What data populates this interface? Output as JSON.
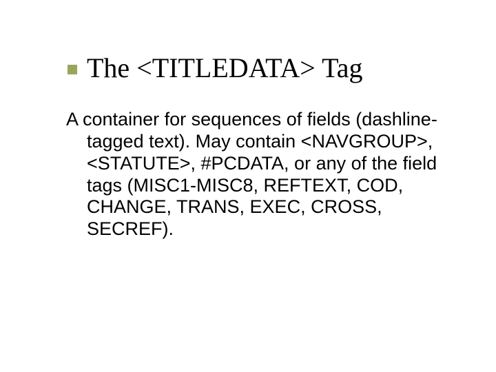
{
  "title": "The <TITLEDATA> Tag",
  "body": "A container for sequences of fields (dashline-tagged text).  May contain <NAVGROUP>, <STATUTE>, #PCDATA, or any of the field tags (MISC1-MISC8, REFTEXT, COD, CHANGE, TRANS, EXEC, CROSS, SECREF)."
}
